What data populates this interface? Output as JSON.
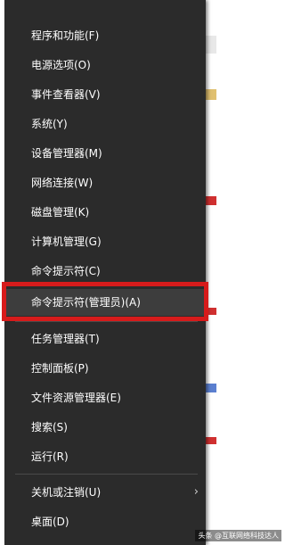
{
  "menu": {
    "items": [
      {
        "label": "程序和功能(F)"
      },
      {
        "label": "电源选项(O)"
      },
      {
        "label": "事件查看器(V)"
      },
      {
        "label": "系统(Y)"
      },
      {
        "label": "设备管理器(M)"
      },
      {
        "label": "网络连接(W)"
      },
      {
        "label": "磁盘管理(K)"
      },
      {
        "label": "计算机管理(G)"
      },
      {
        "label": "命令提示符(C)"
      },
      {
        "label": "命令提示符(管理员)(A)"
      },
      {
        "label": "任务管理器(T)"
      },
      {
        "label": "控制面板(P)"
      },
      {
        "label": "文件资源管理器(E)"
      },
      {
        "label": "搜索(S)"
      },
      {
        "label": "运行(R)"
      },
      {
        "label": "关机或注销(U)"
      },
      {
        "label": "桌面(D)"
      }
    ]
  },
  "watermark": "头条 @互联网络科技达人",
  "colors": {
    "menu_bg": "#2b2b2b",
    "selected_bg": "#3d3d3d",
    "highlight_border": "#d71b1b",
    "text": "#ffffff"
  }
}
